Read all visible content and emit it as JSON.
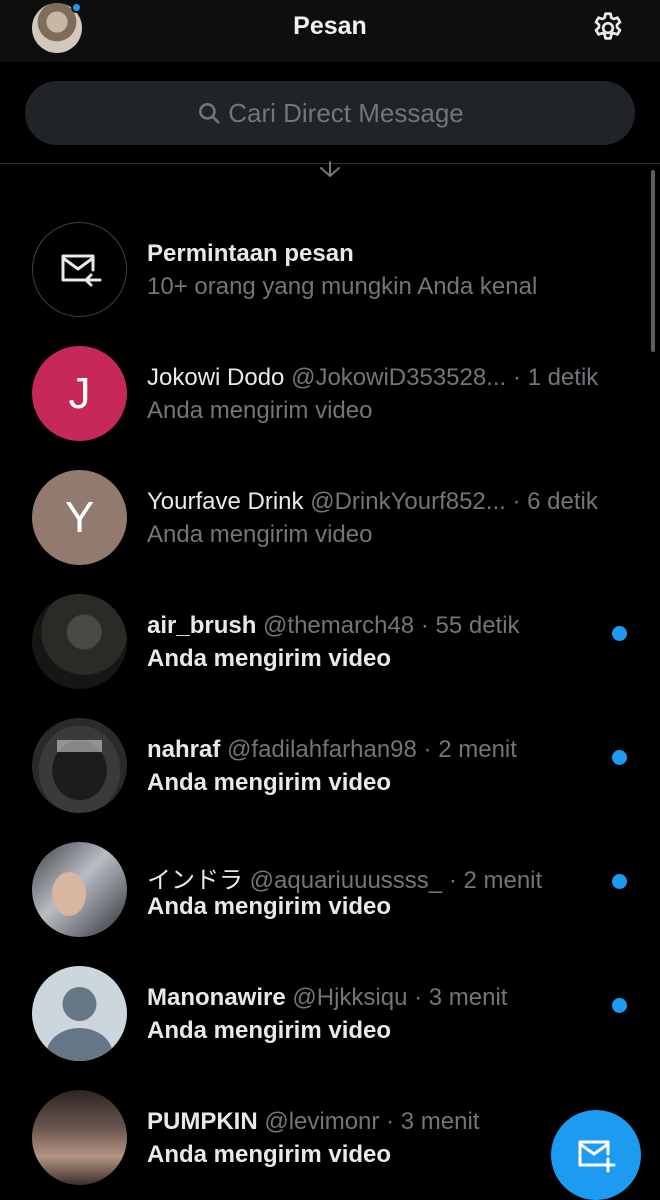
{
  "header": {
    "title": "Pesan",
    "avatar_icon": "profile-avatar",
    "settings_icon": "gear-icon"
  },
  "search": {
    "placeholder": "Cari Direct Message",
    "icon": "search-icon"
  },
  "message_requests": {
    "title": "Permintaan pesan",
    "subtitle": "10+ orang yang mungkin Anda kenal",
    "icon": "mail-request-icon"
  },
  "conversations": [
    {
      "initial": "J",
      "avatar_color": "#c7285a",
      "name": "Jokowi Dodo",
      "handle": "@JokowiD353528...",
      "time": "· 1 detik",
      "preview": "Anda mengirim video",
      "unread": false
    },
    {
      "initial": "Y",
      "avatar_color": "#937a6e",
      "name": "Yourfave Drink",
      "handle": "@DrinkYourf852...",
      "time": "· 6 detik",
      "preview": "Anda mengirim video",
      "unread": false
    },
    {
      "name": "air_brush",
      "handle": "@themarch48",
      "time": "· 55 detik",
      "preview": "Anda mengirim video",
      "unread": true
    },
    {
      "name": "nahraf",
      "handle": "@fadilahfarhan98",
      "time": "· 2 menit",
      "preview": "Anda mengirim video",
      "unread": true
    },
    {
      "name": "インドラ",
      "handle": "@aquariuuussss_",
      "time": "· 2 menit",
      "preview": "Anda mengirim video",
      "unread": true
    },
    {
      "name": "Manonawire",
      "handle": "@Hjkksiqu",
      "time": "· 3 menit",
      "preview": "Anda mengirim video",
      "unread": true
    },
    {
      "name": "PUMPKIN",
      "handle": "@levimonr",
      "time": "· 3 menit",
      "preview": "Anda mengirim video",
      "unread": true
    }
  ],
  "fab": {
    "icon": "new-message-icon"
  },
  "colors": {
    "accent": "#1d9bf0",
    "background": "#000000",
    "muted": "#71767b"
  }
}
